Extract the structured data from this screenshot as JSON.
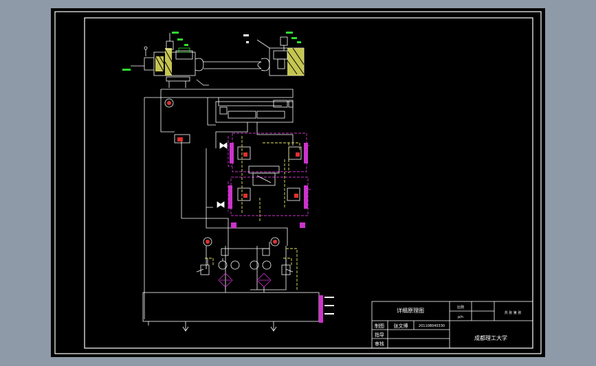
{
  "title_block": {
    "drawing_title": "详细原理图",
    "scale_label": "比例",
    "scale_value": "p/n",
    "cell_right": "共 张  第 张",
    "drawn_by_label": "制图",
    "drawn_by_name": "张文博",
    "student_no": "201108040330",
    "guide_label": "指导",
    "review_label": "审核",
    "institution": "成都理工大学"
  },
  "colors": {
    "frame": "#ffffff",
    "line": "#ffffff",
    "accent_magenta": "#cc33cc",
    "accent_yellow": "#e8e860",
    "accent_red": "#e03030",
    "accent_green": "#30e030"
  }
}
